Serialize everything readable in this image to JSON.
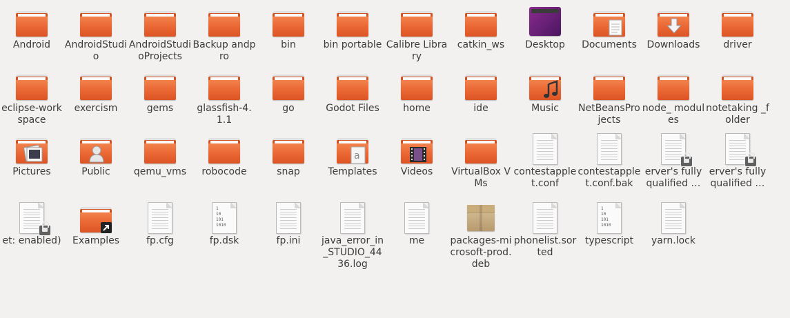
{
  "files": [
    {
      "label": "Android",
      "type": "folder"
    },
    {
      "label": "AndroidStudio",
      "type": "folder"
    },
    {
      "label": "AndroidStudioProjects",
      "type": "folder"
    },
    {
      "label": "Backup andpro",
      "type": "folder"
    },
    {
      "label": "bin",
      "type": "folder"
    },
    {
      "label": "bin portable",
      "type": "folder"
    },
    {
      "label": "Calibre Library",
      "type": "folder"
    },
    {
      "label": "catkin_ws",
      "type": "folder"
    },
    {
      "label": "Desktop",
      "type": "desktop"
    },
    {
      "label": "Documents",
      "type": "folder",
      "emblem": "document"
    },
    {
      "label": "Downloads",
      "type": "folder",
      "emblem": "download"
    },
    {
      "label": "driver",
      "type": "folder"
    },
    {
      "label": "eclipse-workspace",
      "type": "folder"
    },
    {
      "label": "exercism",
      "type": "folder"
    },
    {
      "label": "gems",
      "type": "folder"
    },
    {
      "label": "glassfish-4.1.1",
      "type": "folder"
    },
    {
      "label": "go",
      "type": "folder"
    },
    {
      "label": "Godot Files",
      "type": "folder"
    },
    {
      "label": "home",
      "type": "folder"
    },
    {
      "label": "ide",
      "type": "folder"
    },
    {
      "label": "Music",
      "type": "folder",
      "emblem": "music"
    },
    {
      "label": "NetBeansProjects",
      "type": "folder"
    },
    {
      "label": "node_ modules",
      "type": "folder"
    },
    {
      "label": "notetaking _folder",
      "type": "folder"
    },
    {
      "label": "Pictures",
      "type": "folder",
      "emblem": "picture"
    },
    {
      "label": "Public",
      "type": "folder",
      "emblem": "person"
    },
    {
      "label": "qemu_vms",
      "type": "folder"
    },
    {
      "label": "robocode",
      "type": "folder"
    },
    {
      "label": "snap",
      "type": "folder"
    },
    {
      "label": "Templates",
      "type": "folder",
      "emblem": "template"
    },
    {
      "label": "Videos",
      "type": "folder",
      "emblem": "film"
    },
    {
      "label": "VirtualBox VMs",
      "type": "folder"
    },
    {
      "label": "contestapplet.conf",
      "type": "text"
    },
    {
      "label": "contestapplet.conf.bak",
      "type": "text"
    },
    {
      "label": "erver's fully qualified …",
      "type": "text",
      "lock": true
    },
    {
      "label": "erver's fully qualified …",
      "type": "text",
      "lock": true
    },
    {
      "label": "et: enabled)",
      "type": "text",
      "lock": true
    },
    {
      "label": "Examples",
      "type": "folder",
      "emblem": "link"
    },
    {
      "label": "fp.cfg",
      "type": "text"
    },
    {
      "label": "fp.dsk",
      "type": "binary"
    },
    {
      "label": "fp.ini",
      "type": "text"
    },
    {
      "label": "java_error_in_STUDIO_4436.log",
      "type": "text"
    },
    {
      "label": "me",
      "type": "text"
    },
    {
      "label": "packages-microsoft-prod.deb",
      "type": "deb"
    },
    {
      "label": "phonelist.sorted",
      "type": "text"
    },
    {
      "label": "typescript",
      "type": "binary"
    },
    {
      "label": "yarn.lock",
      "type": "text"
    }
  ],
  "binary_text": "1\n10\n101\n1010",
  "colors": {
    "folder": "#eb6a36",
    "background": "#f2f1f0",
    "desktop": "#6e2277"
  }
}
